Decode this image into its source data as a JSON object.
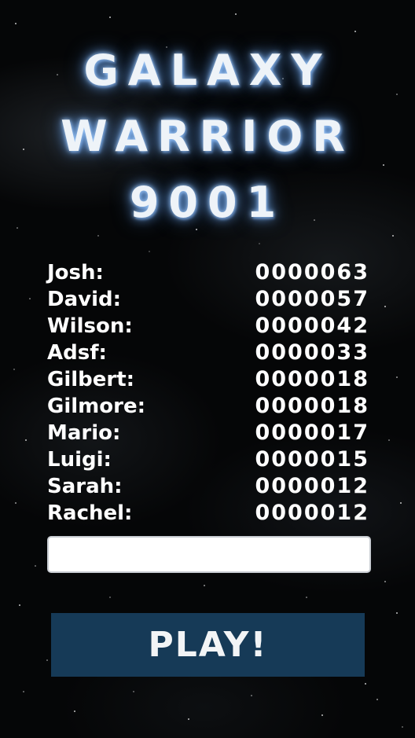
{
  "title": {
    "line1": "GALAXY",
    "line2": "WARRIOR",
    "line3": "9001"
  },
  "scores": [
    {
      "name": "Josh:",
      "score": "0000063"
    },
    {
      "name": "David:",
      "score": "0000057"
    },
    {
      "name": "Wilson:",
      "score": "0000042"
    },
    {
      "name": "Adsf:",
      "score": "0000033"
    },
    {
      "name": "Gilbert:",
      "score": "0000018"
    },
    {
      "name": "Gilmore:",
      "score": "0000018"
    },
    {
      "name": "Mario:",
      "score": "0000017"
    },
    {
      "name": "Luigi:",
      "score": "0000015"
    },
    {
      "name": "Sarah:",
      "score": "0000012"
    },
    {
      "name": "Rachel:",
      "score": "0000012"
    }
  ],
  "name_input": {
    "value": ""
  },
  "play_button": {
    "label": "PLAY!"
  },
  "colors": {
    "background": "#050607",
    "title_glow": "#78b4ff",
    "button": "#163a57",
    "text": "#ffffff"
  }
}
